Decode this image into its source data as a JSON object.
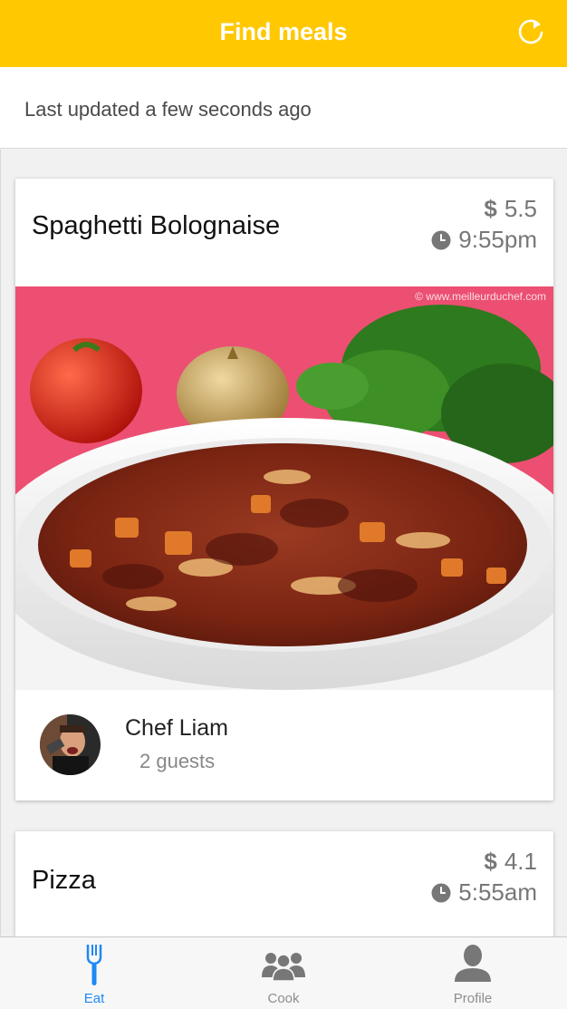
{
  "header": {
    "title": "Find meals",
    "refresh_icon": "refresh-icon"
  },
  "status": {
    "updated": "Last updated a few seconds ago"
  },
  "meals": [
    {
      "title": "Spaghetti Bolognaise",
      "price_symbol": "$",
      "price": "5.5",
      "time": "9:55pm",
      "photo_watermark": "© www.meilleurduchef.com",
      "chef": "Chef Liam",
      "guests": "2 guests"
    },
    {
      "title": "Pizza",
      "price_symbol": "$",
      "price": "4.1",
      "time": "5:55am"
    }
  ],
  "tabs": [
    {
      "label": "Eat",
      "icon": "fork-icon",
      "active": true
    },
    {
      "label": "Cook",
      "icon": "group-icon",
      "active": false
    },
    {
      "label": "Profile",
      "icon": "person-icon",
      "active": false
    }
  ],
  "colors": {
    "accent": "#FFC800",
    "active_tab": "#1E88F5",
    "muted": "#777777"
  }
}
